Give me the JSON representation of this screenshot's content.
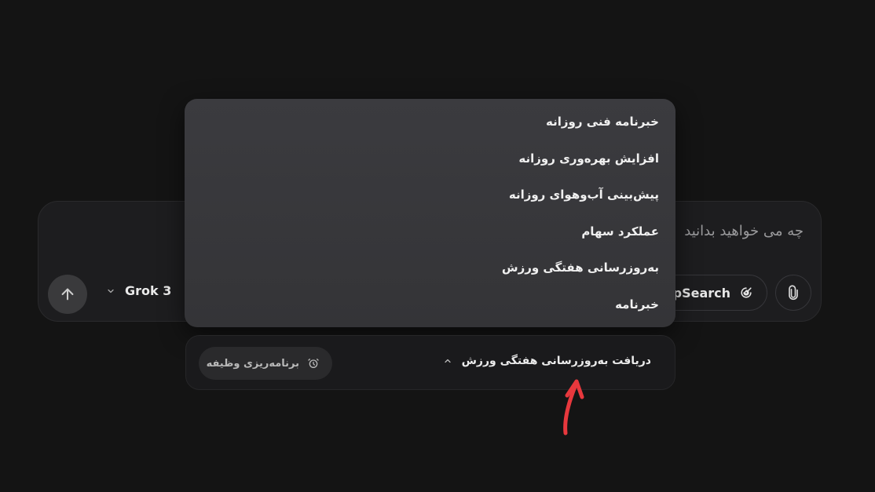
{
  "chat": {
    "placeholder": "چه می خواهید بدانید",
    "deepsearch_label": "DeepSearch",
    "model_label": "Grok 3"
  },
  "dropdown": {
    "items": [
      "خبرنامه فنی روزانه",
      "افزایش بهره‌وری روزانه",
      "پیش‌بینی آب‌وهوای روزانه",
      "عملکرد سهام",
      "به‌روزرسانی هفتگی ورزش",
      "خبرنامه"
    ]
  },
  "task_bar": {
    "selected": "دریافت به‌روزرسانی هفتگی ورزش",
    "schedule_label": "برنامه‌ریزی وظیفه"
  },
  "colors": {
    "background": "#141414",
    "annotation_arrow": "#e8383d"
  }
}
